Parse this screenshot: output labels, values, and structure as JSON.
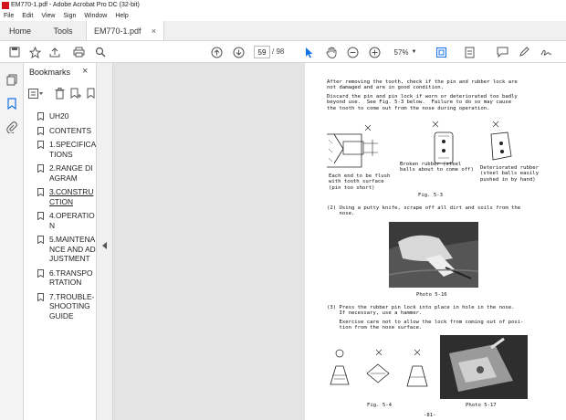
{
  "window": {
    "title": "EM770-1.pdf - Adobe Acrobat Pro DC (32-bit)"
  },
  "menu": [
    "File",
    "Edit",
    "View",
    "Sign",
    "Window",
    "Help"
  ],
  "tabs": {
    "home": "Home",
    "tools": "Tools",
    "document": "EM770-1.pdf",
    "close": "×"
  },
  "toolbar": {
    "page_current": "59",
    "page_total": "/ 98",
    "zoom": "57%"
  },
  "bookmarks": {
    "title": "Bookmarks",
    "close": "×",
    "items": [
      {
        "label": "UH20"
      },
      {
        "label": "CONTENTS"
      },
      {
        "label": "1.SPECIFICATIONS"
      },
      {
        "label": "2.RANGE DIAGRAM"
      },
      {
        "label": "3.CONSTRUCTION"
      },
      {
        "label": "4.OPERATION"
      },
      {
        "label": "5.MAINTENANCE AND ADJUSTMENT"
      },
      {
        "label": "6.TRANSPORTATION"
      },
      {
        "label": "7.TROUBLE-SHOOTING GUIDE"
      }
    ]
  },
  "document": {
    "para1": "After removing the tooth, check if the pin and rubber lock are\nnot damaged and are in good condition.",
    "para2": "Discard the pin and pin lock if worn or deteriorated too badly\nbeyond use.  See Fig. 5-3 below.  Failure to do so may cause\nthe tooth to come out from the nose during operation.",
    "cap_left": "Each end to be flush\nwith tooth surface\n(pin too short)",
    "cap_mid": "Broken rubber (steel\nballs about to come off)",
    "cap_right": "Deteriorated rubber\n(steel balls easily\npushed in by hand)",
    "fig53": "Fig. 5-3",
    "step2": "(2) Using a putty knife, scrape off all dirt and soils from the\n    nose.",
    "photo516": "Photo 5-16",
    "step3": "(3) Press the rubber pin lock into place in hole in the nose.\n    If necessary, use a hammer.",
    "step3b": "    Exercise care not to allow the lock from coming out of posi-\n    tion from the nose surface.",
    "fig54": "Fig. 5-4",
    "photo517": "Photo 5-17",
    "pagefoot": "-81-"
  },
  "colors": {
    "accent": "#1473e6",
    "app_red": "#d2141d"
  }
}
